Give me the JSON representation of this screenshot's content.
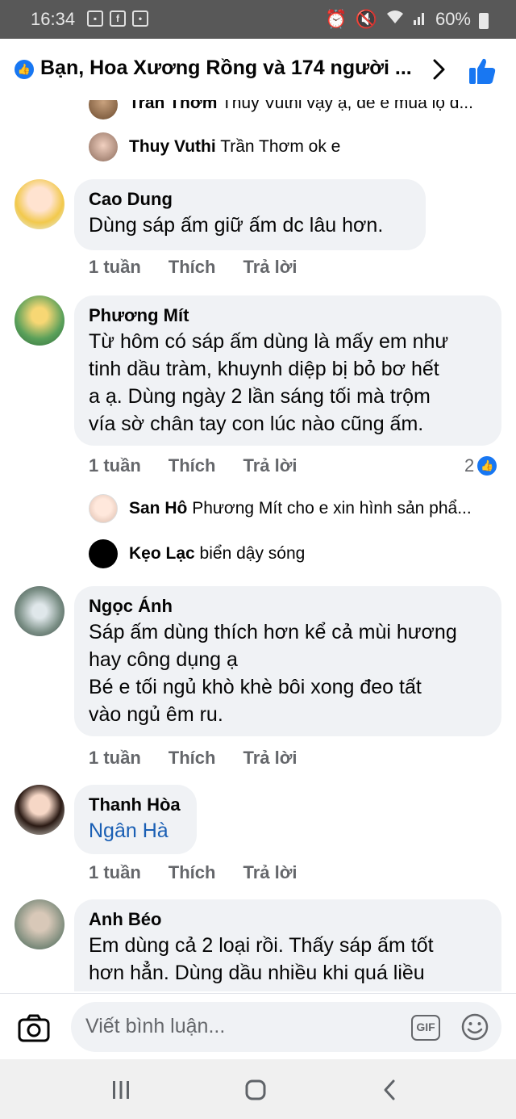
{
  "status_bar": {
    "time": "16:34",
    "battery": "60%",
    "left_icons": [
      "image-icon",
      "facebook-icon",
      "notification-icon"
    ],
    "right_icons": [
      "alarm-icon",
      "mute-icon",
      "wifi-icon",
      "signal-icon",
      "battery-icon"
    ]
  },
  "header": {
    "reactions_text": "Bạn, Hoa Xương Rồng và 174 người ...",
    "accent_color": "#1877f2"
  },
  "comments": [
    {
      "type": "reply",
      "name": "Trần Thơm",
      "text": "Thuy Vuthi vậy ạ, để e mua lọ d..."
    },
    {
      "type": "reply",
      "name": "Thuy Vuthi",
      "text": "Trần Thơm ok e"
    },
    {
      "type": "comment",
      "name": "Cao Dung",
      "lines": [
        "Dùng sáp ấm giữ ấm dc lâu hơn."
      ],
      "time": "1 tuần",
      "like": "Thích",
      "reply": "Trả lời"
    },
    {
      "type": "comment",
      "name": "Phương Mít",
      "lines": [
        "Từ hôm có sáp ấm dùng là mấy em như",
        "tinh dầu tràm, khuynh diệp bị bỏ bơ hết",
        "a ạ. Dùng ngày 2 lần sáng tối mà trộm",
        "vía sờ chân tay con lúc nào cũng ấm."
      ],
      "time": "1 tuần",
      "like": "Thích",
      "reply": "Trả lời",
      "reactions": "2"
    },
    {
      "type": "reply",
      "name": "San Hô",
      "text": "Phương Mít cho e xin hình sản phẩ..."
    },
    {
      "type": "reply",
      "name": "Kẹo Lạc",
      "text": "biển dậy sóng"
    },
    {
      "type": "comment",
      "name": "Ngọc Ánh",
      "lines": [
        "Sáp ấm dùng thích hơn kể cả mùi hương",
        "hay công dụng ạ",
        "Bé e tối ngủ khò khè bôi xong đeo tất",
        "vào ngủ êm ru."
      ],
      "time": "1 tuần",
      "like": "Thích",
      "reply": "Trả lời"
    },
    {
      "type": "comment",
      "name": "Thanh Hòa",
      "lines": [
        "Ngân Hà"
      ],
      "time": "1 tuần",
      "like": "Thích",
      "reply": "Trả lời"
    },
    {
      "type": "comment",
      "name": "Anh Béo",
      "lines": [
        "Em dùng cả 2 loại rồi. Thấy sáp ấm tốt",
        "hơn hẳn. Dùng dầu nhiều khi quá liều"
      ]
    }
  ],
  "composer": {
    "placeholder": "Viết bình luận...",
    "gif_label": "GIF"
  }
}
